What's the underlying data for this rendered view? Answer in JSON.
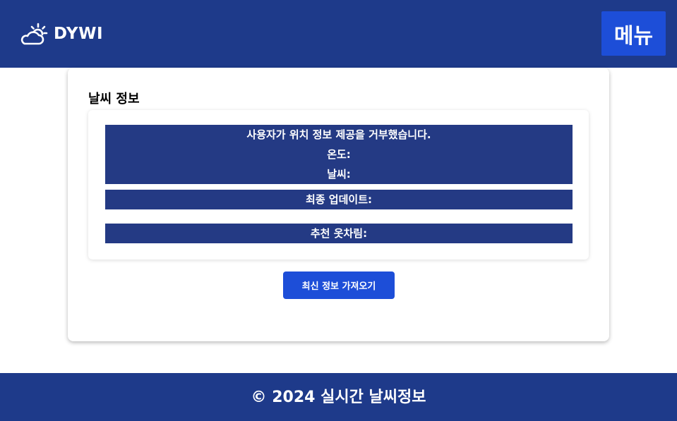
{
  "header": {
    "brand": "DYWI",
    "brand_icon": "sun-cloud-icon",
    "menu_label": "메뉴"
  },
  "card": {
    "title": "날씨 정보",
    "status_message": "사용자가 위치 정보 제공을 거부했습니다.",
    "temperature_label": "온도:",
    "weather_label": "날씨:",
    "last_update_label": "최종 업데이트:",
    "outfit_label": "추천 옷차림:",
    "refresh_label": "최신 정보 가져오기"
  },
  "footer": {
    "copyright": "© 2024 실시간 날씨정보"
  },
  "colors": {
    "primary_dark": "#1e3a8a",
    "button_blue": "#1d4ed8",
    "info_block": "#243a84"
  }
}
